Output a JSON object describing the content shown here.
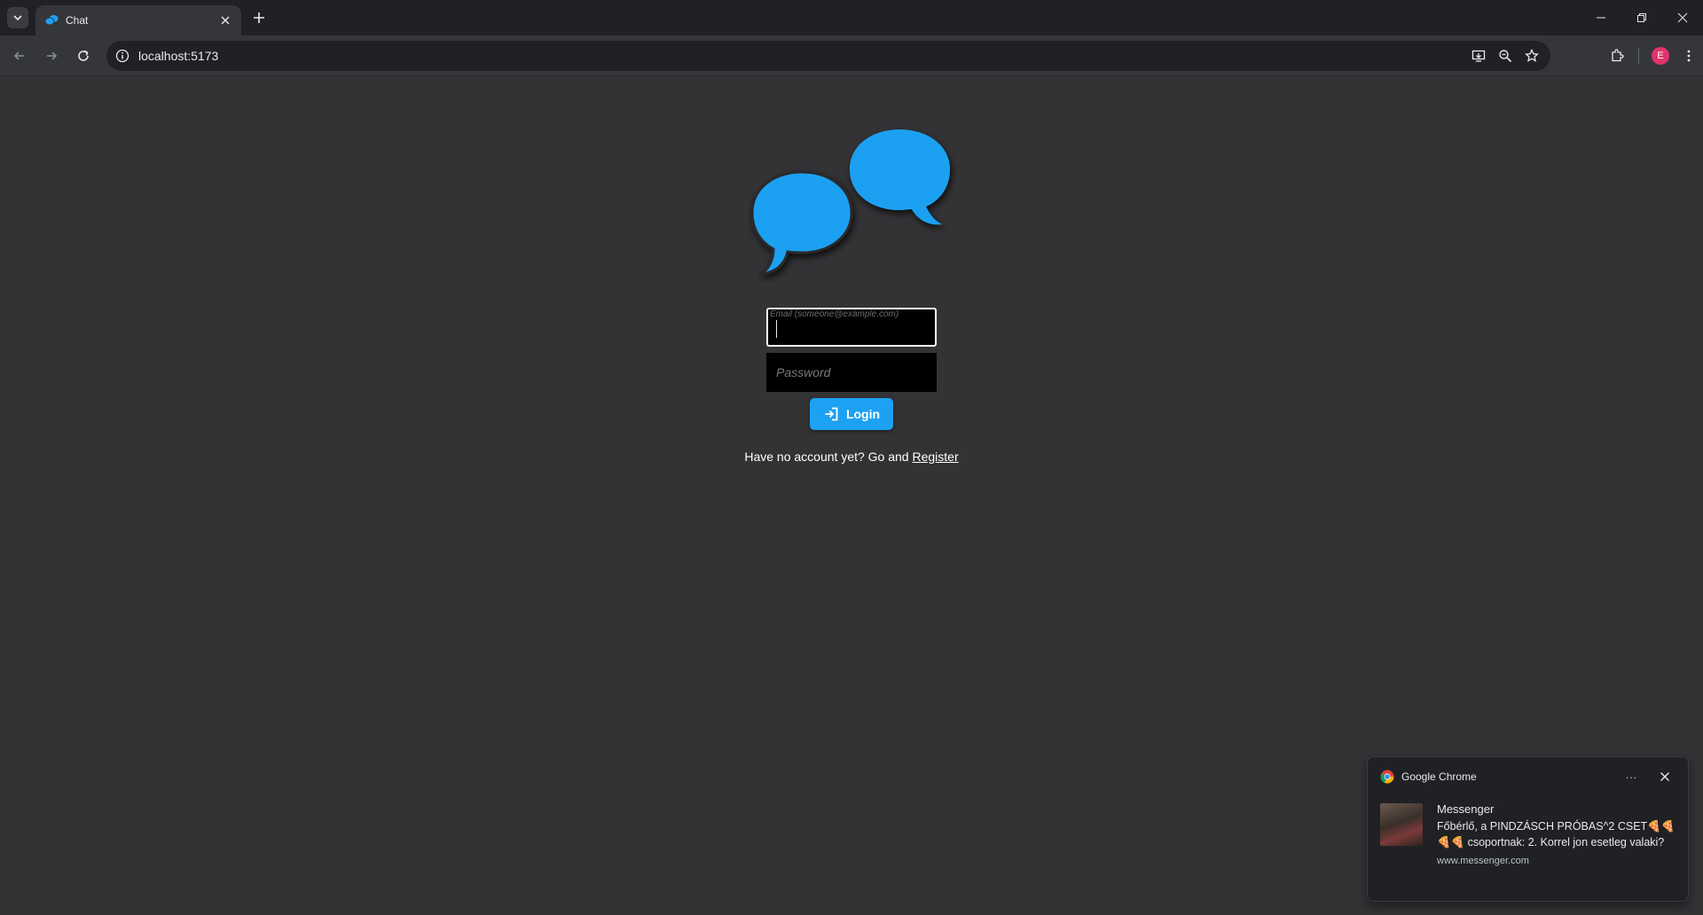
{
  "browser": {
    "tab_title": "Chat",
    "url": "localhost:5173",
    "profile_initial": "E"
  },
  "login": {
    "email_label": "Email (someone@example.com)",
    "email_value": "",
    "password_placeholder": "Password",
    "login_label": "Login",
    "register_prompt": "Have no account yet? Go and",
    "register_link": "Register"
  },
  "notification": {
    "app_name": "Google Chrome",
    "title": "Messenger",
    "message": "Főbérlő, a PINDZÁSCH PRÓBAS^2 CSET🍕🍕🍕🍕 csoportnak: 2. Korrel jon esetleg valaki?",
    "source": "www.messenger.com",
    "more_label": "···"
  },
  "colors": {
    "accent": "#1da1f2",
    "page_bg": "#333336",
    "chrome_bg": "#202124"
  },
  "icons": {
    "logo": "chat-bubbles-icon",
    "login": "sign-in-icon"
  }
}
